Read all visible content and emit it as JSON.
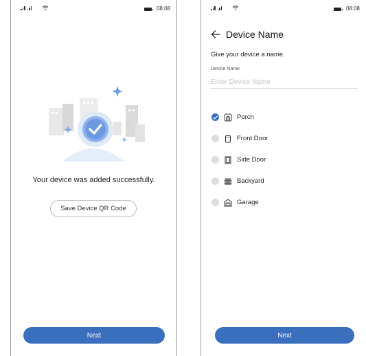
{
  "status_bar": {
    "time": "08:08"
  },
  "success_screen": {
    "message": "Your device was added successfully.",
    "save_qr_label": "Save Device QR Code",
    "next_label": "Next"
  },
  "name_screen": {
    "title": "Device Name",
    "prompt": "Give your device a name.",
    "field_label": "Device Name",
    "field_placeholder": "Enter Device Name",
    "field_value": "",
    "options": [
      {
        "label": "Porch",
        "icon": "porch-icon",
        "selected": true
      },
      {
        "label": "Front Door",
        "icon": "front-door-icon",
        "selected": false
      },
      {
        "label": "Side Door",
        "icon": "side-door-icon",
        "selected": false
      },
      {
        "label": "Backyard",
        "icon": "backyard-fence-icon",
        "selected": false
      },
      {
        "label": "Garage",
        "icon": "garage-icon",
        "selected": false
      }
    ],
    "next_label": "Next"
  },
  "colors": {
    "accent": "#3a6fbe",
    "radio_unselected": "#dedede",
    "text": "#222222",
    "placeholder": "#c6c6c6"
  }
}
